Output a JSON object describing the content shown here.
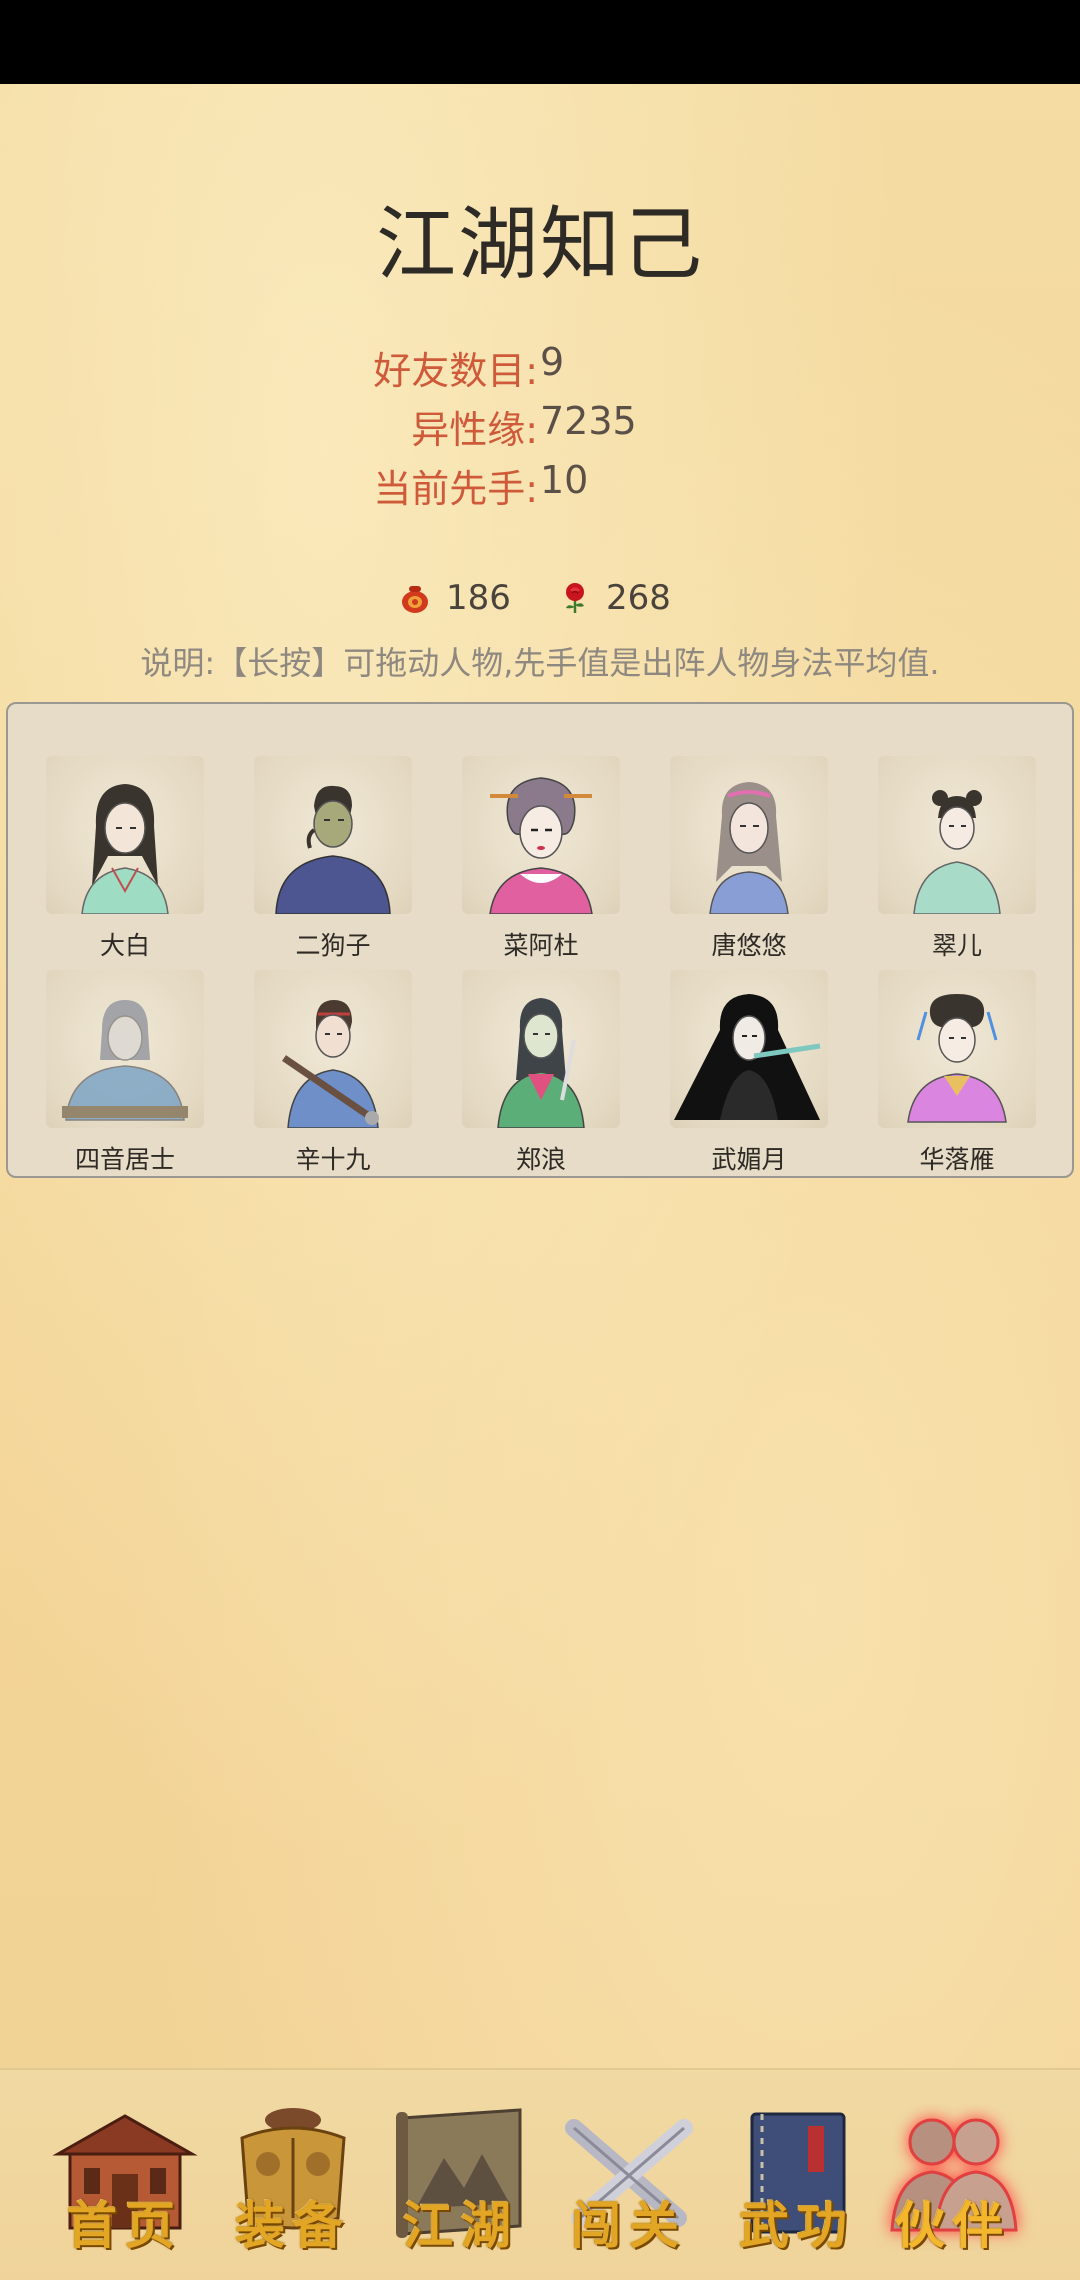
{
  "page": {
    "title": "江湖知己"
  },
  "stats": [
    {
      "label": "好友数目:",
      "value": "9"
    },
    {
      "label": "异性缘:",
      "value": "7235"
    },
    {
      "label": "当前先手:",
      "value": "10"
    }
  ],
  "currency": {
    "bag": {
      "icon": "red-pouch-icon",
      "value": "186"
    },
    "rose": {
      "icon": "rose-icon",
      "value": "268"
    }
  },
  "note": "说明:【长按】可拖动人物,先手值是出阵人物身法平均值.",
  "characters": [
    {
      "name": "大白"
    },
    {
      "name": "二狗子"
    },
    {
      "name": "菜阿杜"
    },
    {
      "name": "唐悠悠"
    },
    {
      "name": "翠儿"
    },
    {
      "name": "四音居士"
    },
    {
      "name": "辛十九"
    },
    {
      "name": "郑浪"
    },
    {
      "name": "武媚月"
    },
    {
      "name": "华落雁"
    }
  ],
  "nav": [
    {
      "label": "首页",
      "icon": "house-icon"
    },
    {
      "label": "装备",
      "icon": "armor-icon"
    },
    {
      "label": "江湖",
      "icon": "scroll-map-icon"
    },
    {
      "label": "闯关",
      "icon": "crossed-swords-icon"
    },
    {
      "label": "武功",
      "icon": "book-icon"
    },
    {
      "label": "伙伴",
      "icon": "partners-icon",
      "active": true
    }
  ],
  "colors": {
    "background": "#f3d89c",
    "label_red": "#cf5a3a",
    "nav_gold": "#e3a524",
    "active_glow": "#ff4040"
  }
}
